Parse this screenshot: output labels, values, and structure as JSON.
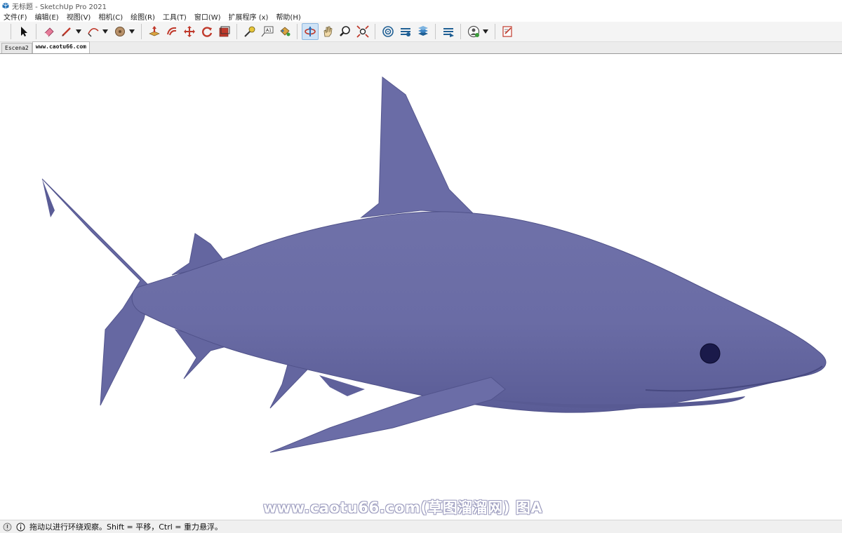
{
  "window": {
    "title": "无标题 - SketchUp Pro 2021"
  },
  "menu": [
    {
      "label": "文件(F)"
    },
    {
      "label": "编辑(E)"
    },
    {
      "label": "视图(V)"
    },
    {
      "label": "相机(C)"
    },
    {
      "label": "绘图(R)"
    },
    {
      "label": "工具(T)"
    },
    {
      "label": "窗口(W)"
    },
    {
      "label": "扩展程序 (x)"
    },
    {
      "label": "帮助(H)"
    }
  ],
  "toolbar": {
    "active_tool": "orbit-icon",
    "tools": [
      "select-icon",
      "eraser-icon",
      "line-icon",
      "arc-icon",
      "shapes-icon",
      "push-pull-icon",
      "offset-icon",
      "move-icon",
      "rotate-icon",
      "scale-icon",
      "tape-measure-icon",
      "text-icon",
      "paint-bucket-icon",
      "orbit-icon",
      "pan-icon",
      "zoom-icon",
      "zoom-extents-icon",
      "warehouse-icon",
      "extension-warehouse-icon",
      "layout-icon",
      "share-model-icon",
      "account-icon",
      "preview-icon"
    ]
  },
  "tabs": [
    {
      "label": "Escena2"
    },
    {
      "label": "www.caotu66.com"
    }
  ],
  "viewport": {
    "watermark": "www.caotu66.com(草图溜溜网) 图A",
    "model_color": "#6b6da3"
  },
  "status": {
    "message": "拖动以进行环绕观察。Shift = 平移，Ctrl = 重力悬浮。"
  }
}
